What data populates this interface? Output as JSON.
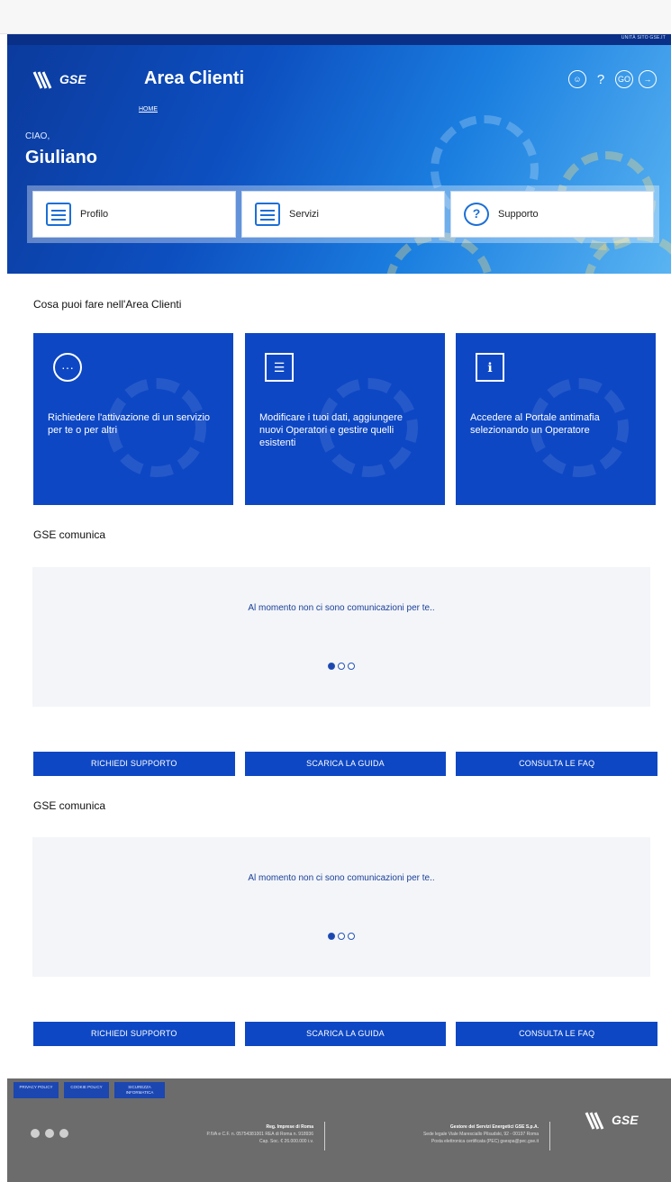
{
  "topbar": {
    "util_link": "UNITÀ SITO GSE.IT"
  },
  "header": {
    "logo_text": "GSE",
    "app_title": "Area Clienti",
    "home_link": "HOME",
    "icons": [
      "support-icon",
      "help-icon",
      "go-icon",
      "logout-icon"
    ],
    "go_label": "GO"
  },
  "greeting": {
    "small": "CIAO,",
    "name": "Giuliano"
  },
  "quick_links": [
    {
      "label": "Profilo",
      "icon": "profile-card-icon"
    },
    {
      "label": "Servizi",
      "icon": "services-doc-icon"
    },
    {
      "label": "Supporto",
      "icon": "support-help-icon"
    }
  ],
  "features_title": "Cosa puoi fare nell'Area Clienti",
  "features": [
    {
      "text": "Richiedere l'attivazione di un servizio per te o per altri",
      "icon": "chat-bubble-icon"
    },
    {
      "text": "Modificare i tuoi dati, aggiungere nuovi Operatori e gestire quelli esistenti",
      "icon": "cabinet-icon"
    },
    {
      "text": "Accedere al Portale antimafia selezionando un Operatore",
      "icon": "document-info-icon"
    }
  ],
  "communications": [
    {
      "title": "GSE comunica",
      "message": "Al momento non ci sono comunicazioni per te..",
      "buttons": [
        "RICHIEDI SUPPORTO",
        "SCARICA LA GUIDA",
        "CONSULTA LE FAQ"
      ]
    },
    {
      "title": "GSE comunica",
      "message": "Al momento non ci sono comunicazioni per te..",
      "buttons": [
        "RICHIEDI SUPPORTO",
        "SCARICA LA GUIDA",
        "CONSULTA LE FAQ"
      ]
    }
  ],
  "footer": {
    "buttons": [
      "PRIVACY POLICY",
      "COOKIE POLICY",
      "SICUREZZA INFORMATICA"
    ],
    "registry_title": "Reg. Imprese di Roma",
    "registry_line1": "P.IVA e C.F. n. 05754381001 REA di Roma n. 918936",
    "registry_line2": "Cap. Soc. € 26.000.000 i.v.",
    "company_title": "Gestore dei Servizi Energetici GSE S.p.A.",
    "company_line1": "Sede legale Viale Maresciallo Pilsudski, 92 - 00197 Roma",
    "company_line2": "Posta elettronica certificata (PEC) gsespa@pec.gse.it",
    "logo_text": "GSE"
  },
  "colors": {
    "brand_blue": "#0d47c4",
    "footer_gray": "#6c6c6c",
    "panel_bg": "#f3f5f8"
  }
}
